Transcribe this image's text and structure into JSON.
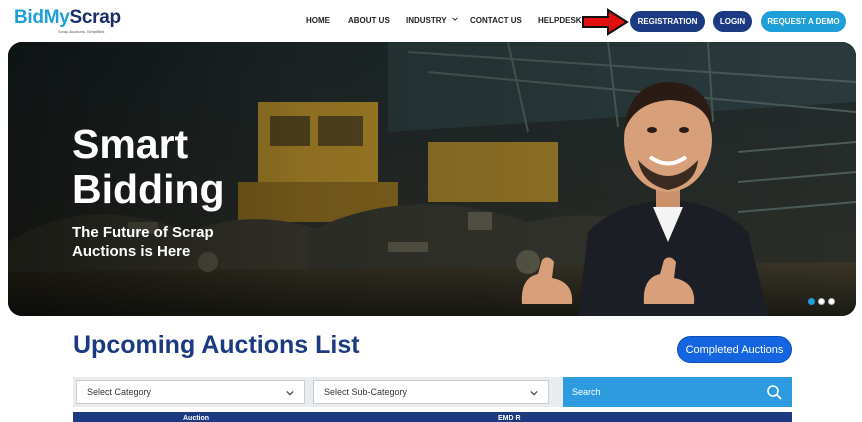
{
  "brand": {
    "logo_text_bid": "idMy",
    "logo_text_scrap": "Scrap",
    "logo_b": "B",
    "tagline": "Scrap Auctions. Simplified."
  },
  "nav": {
    "home": "HOME",
    "about": "ABOUT US",
    "industry": "INDUSTRY",
    "contact": "CONTACT US",
    "helpdesk": "HELPDESK",
    "registration": "REGISTRATION",
    "login": "LOGIN",
    "demo": "REQUEST A DEMO"
  },
  "hero": {
    "title_line1": "Smart",
    "title_line2": "Bidding",
    "subtitle": "The Future of Scrap Auctions is Here",
    "slides_total": 3,
    "active_slide": 1
  },
  "auctions": {
    "title": "Upcoming Auctions List",
    "completed_button": "Completed Auctions",
    "category_select": "Select Category",
    "subcategory_select": "Select Sub-Category",
    "search_placeholder": "Search",
    "table_headers": [
      "Auction",
      "EMD R"
    ]
  },
  "colors": {
    "brand_navy": "#1c3a82",
    "brand_blue": "#1e9fd8",
    "annotation_arrow": "#e01010"
  },
  "icons": [
    "chevron-down-icon",
    "search-icon",
    "red-arrow-icon"
  ]
}
